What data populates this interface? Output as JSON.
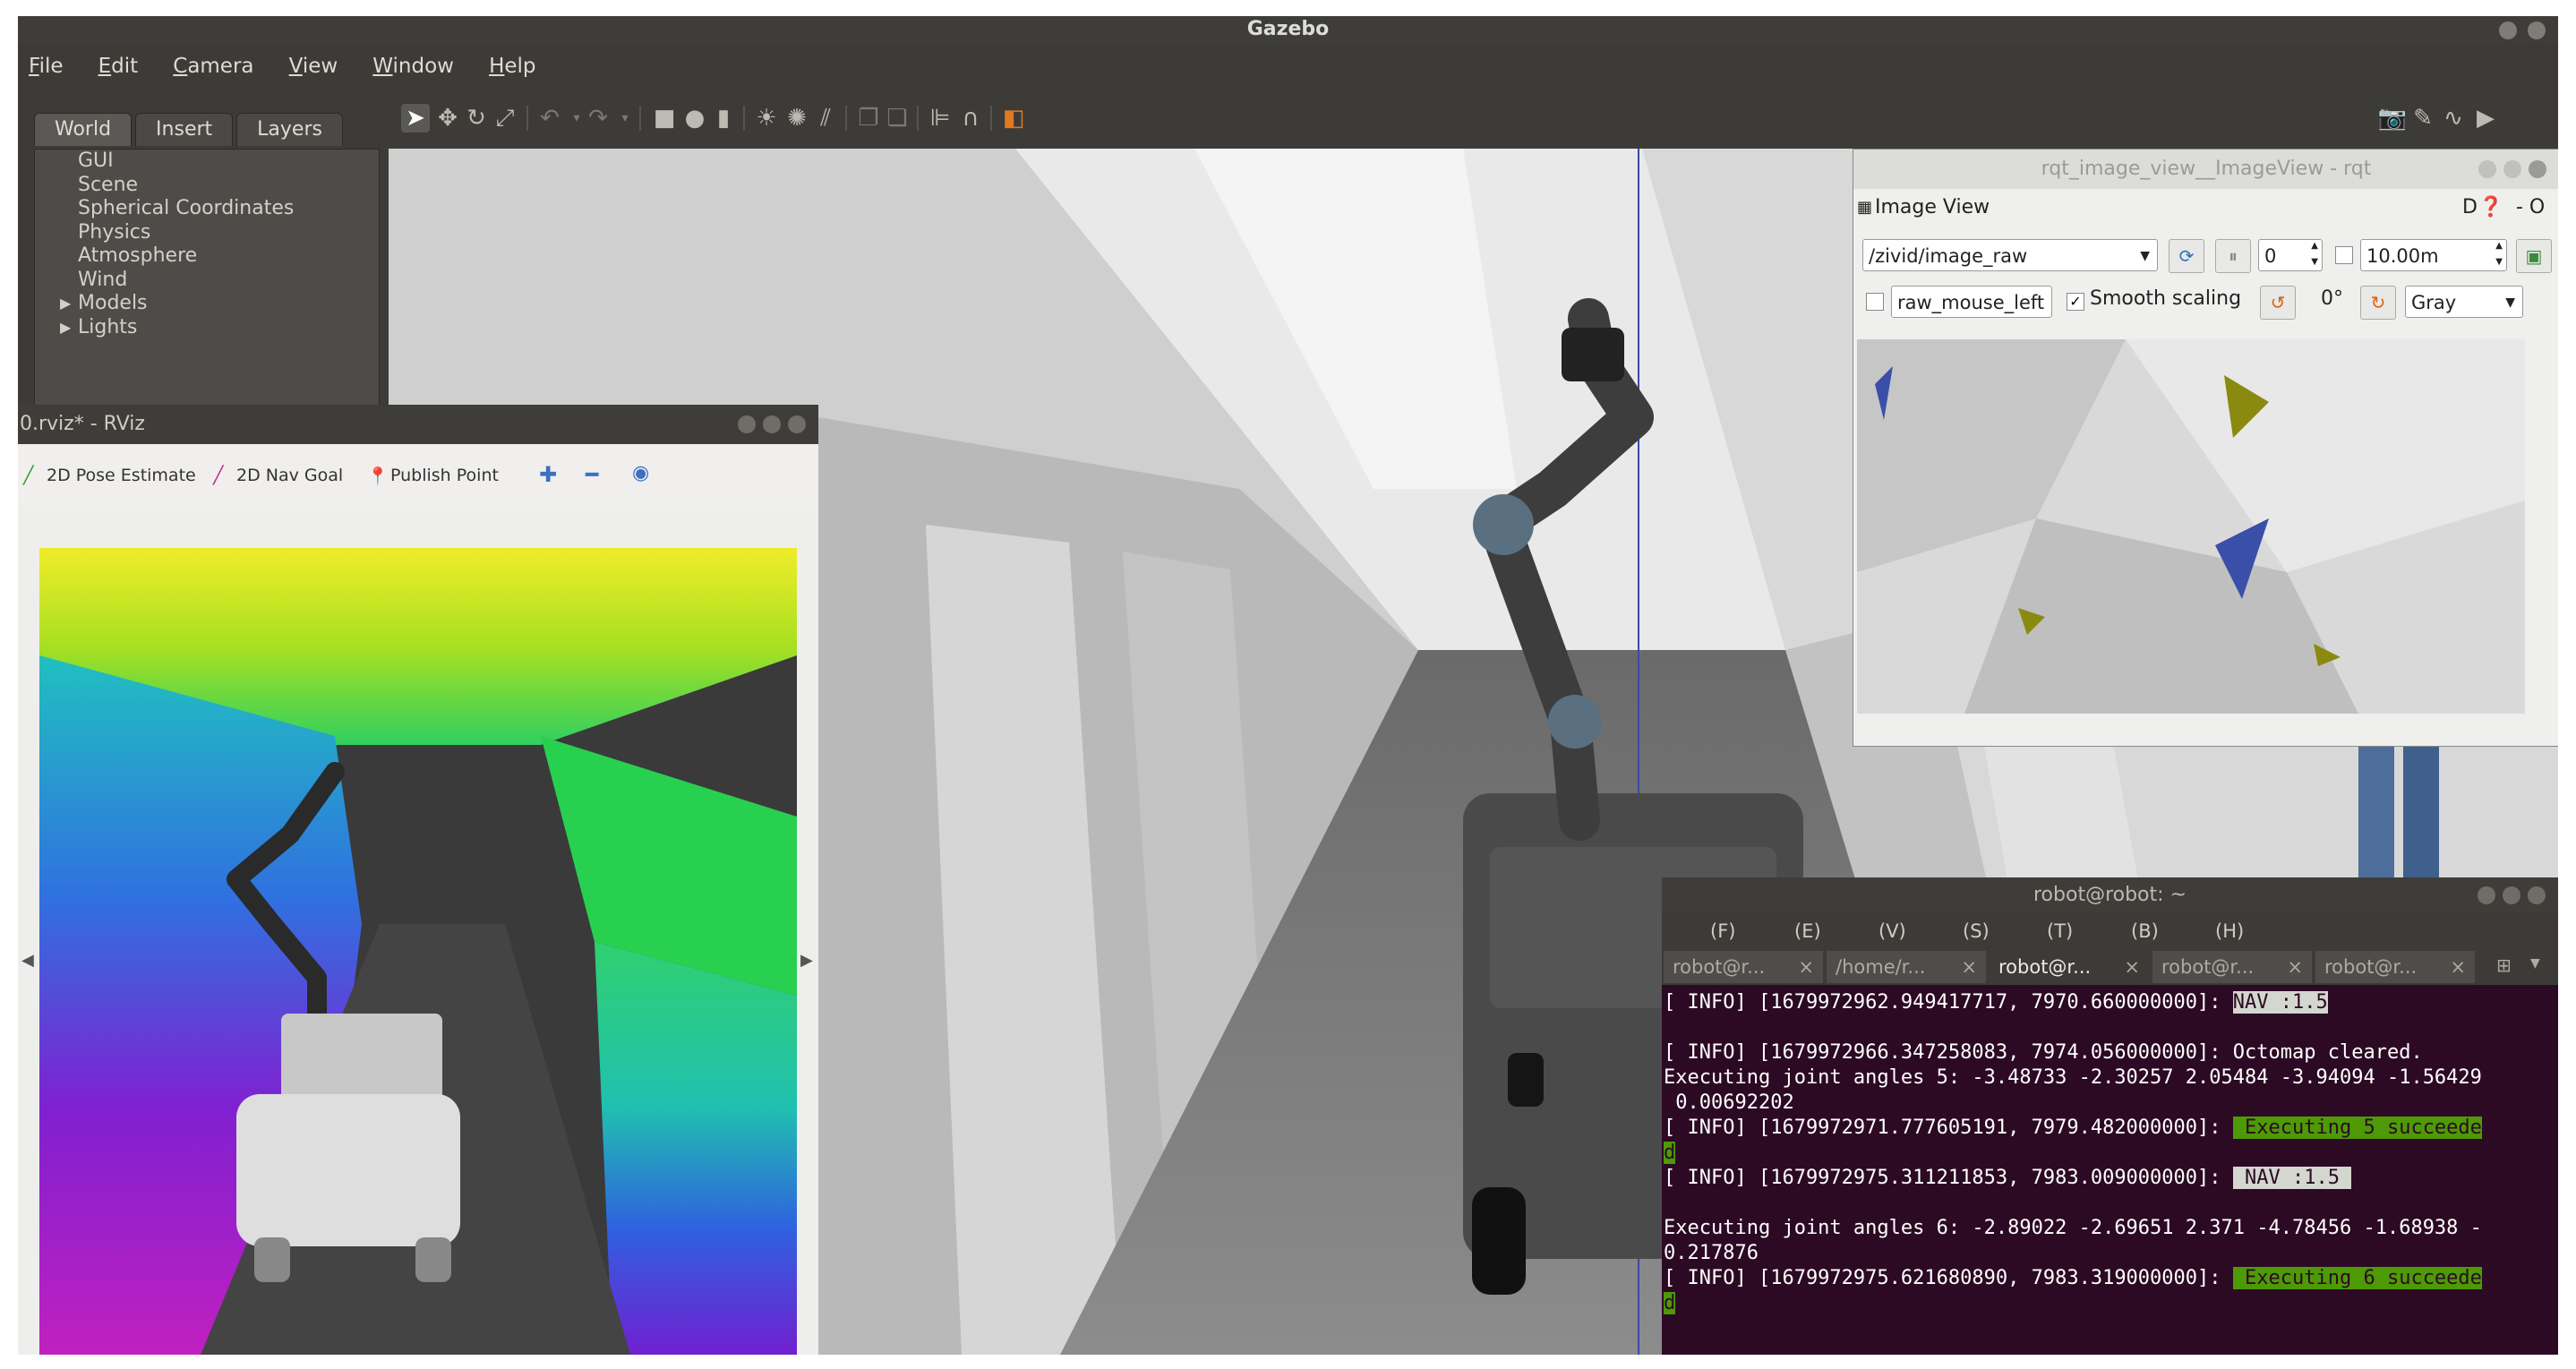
{
  "app": {
    "title": "Gazebo"
  },
  "menu": [
    {
      "label": "File",
      "u": "F",
      "rest": "ile"
    },
    {
      "label": "Edit",
      "u": "E",
      "rest": "dit"
    },
    {
      "label": "Camera",
      "u": "C",
      "rest": "amera"
    },
    {
      "label": "View",
      "u": "V",
      "rest": "iew"
    },
    {
      "label": "Window",
      "u": "W",
      "rest": "indow"
    },
    {
      "label": "Help",
      "u": "H",
      "rest": "elp"
    }
  ],
  "left_tabs": [
    "World",
    "Insert",
    "Layers"
  ],
  "world_tree": [
    "GUI",
    "Scene",
    "Spherical Coordinates",
    "Physics",
    "Atmosphere",
    "Wind",
    "Models",
    "Lights"
  ],
  "rviz": {
    "title": "0.rviz* - RViz",
    "tools": [
      "2D Pose Estimate",
      "2D Nav Goal",
      "Publish Point"
    ]
  },
  "rqt": {
    "title": "rqt_image_view__ImageView - rqt",
    "panel_title": "Image View",
    "topic": "/zivid/image_raw",
    "spin_value": "0",
    "max_range": "10.00m",
    "mouse_topic": "raw_mouse_left",
    "smooth_label": "Smooth scaling",
    "rotation": "0°",
    "colormap": "Gray",
    "corner_letter": "D",
    "corner_right": "- O"
  },
  "terminal": {
    "title": "robot@robot: ~",
    "menu": [
      "(F)",
      "(E)",
      "(V)",
      "(S)",
      "(T)",
      "(B)",
      "(H)"
    ],
    "tabs": [
      "robot@r...",
      "/home/r...",
      "robot@r...",
      "robot@r...",
      "robot@r..."
    ],
    "lines": [
      {
        "text": "[ INFO] [1679972962.949417717, 7970.660000000]: ",
        "badge": "NAV :1.5",
        "badge_style": "hl"
      },
      {
        "text": ""
      },
      {
        "text": "[ INFO] [1679972966.347258083, 7974.056000000]: Octomap cleared."
      },
      {
        "text": "Executing joint angles 5: -3.48733 -2.30257 2.05484 -3.94094 -1.56429"
      },
      {
        "text": " 0.00692202"
      },
      {
        "text": "[ INFO] [1679972971.777605191, 7979.482000000]: ",
        "badge": " Executing 5 succeede",
        "badge_style": "hg"
      },
      {
        "text": "",
        "badge": "d",
        "badge_style": "hg"
      },
      {
        "text": "[ INFO] [1679972975.311211853, 7983.009000000]: ",
        "badge": " NAV :1.5 ",
        "badge_style": "hl"
      },
      {
        "text": ""
      },
      {
        "text": "Executing joint angles 6: -2.89022 -2.69651 2.371 -4.78456 -1.68938 -"
      },
      {
        "text": "0.217876"
      },
      {
        "text": "[ INFO] [1679972975.621680890, 7983.319000000]: ",
        "badge": " Executing 6 succeede",
        "badge_style": "hg"
      },
      {
        "text": "",
        "badge": "d",
        "badge_style": "hg"
      }
    ]
  },
  "colors": {
    "terminal_bg": "#2c0a23",
    "ubuntu_dark": "#3c3b37",
    "success_green": "#4e9a06"
  }
}
